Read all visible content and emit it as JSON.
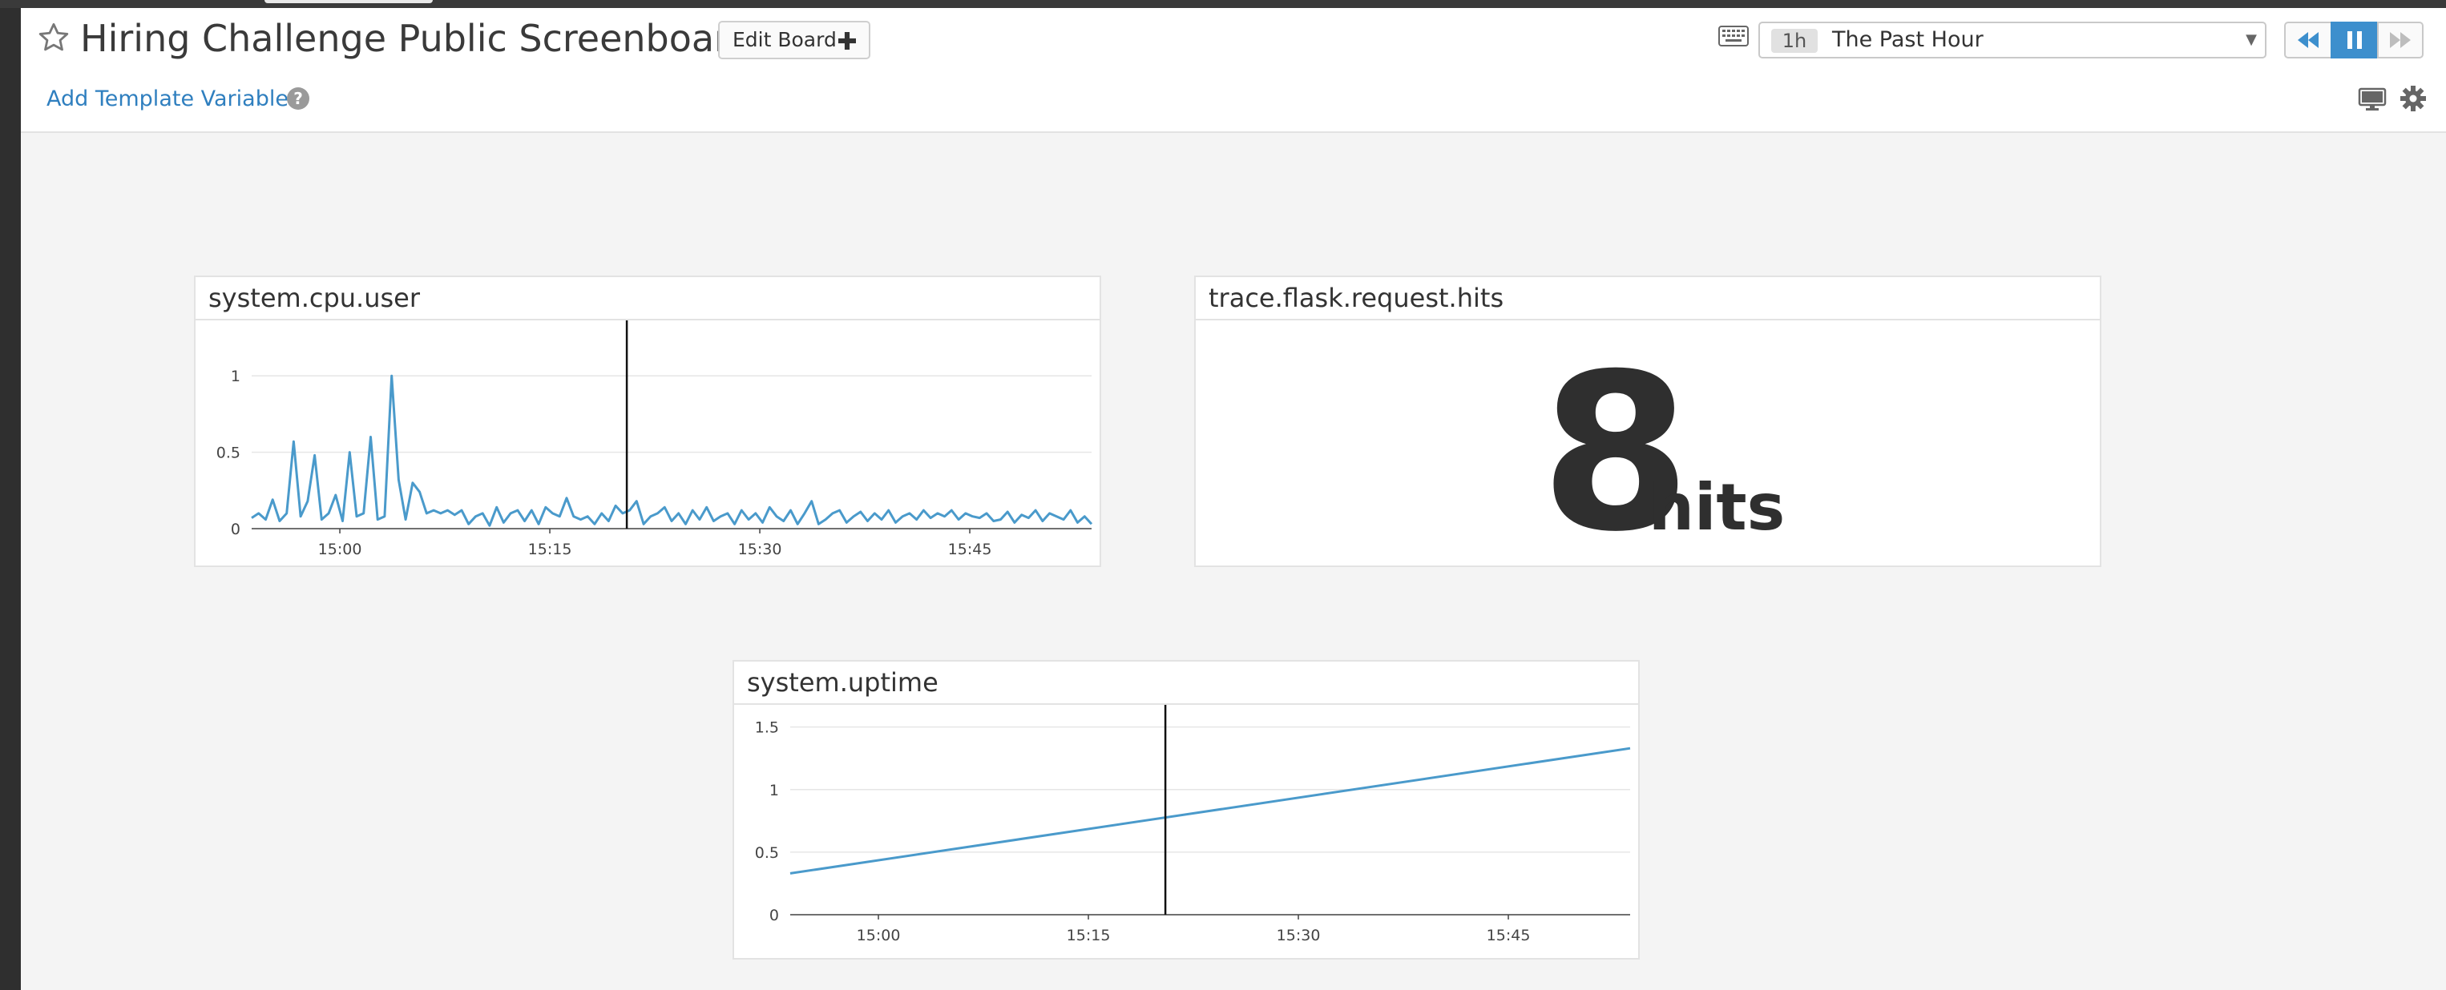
{
  "header": {
    "title": "Hiring Challenge Public Screenboard",
    "edit_label": "Edit Board",
    "add_template_label": "Add Template Variables",
    "timeframe": {
      "chip": "1h",
      "label": "The Past Hour"
    }
  },
  "colors": {
    "accent": "#3d8fcd",
    "series": "#4a9acb",
    "link": "#2f7fbf"
  },
  "widgets": {
    "cpu": {
      "title": "system.cpu.user"
    },
    "hits": {
      "title": "trace.flask.request.hits",
      "value": "8",
      "unit": "hits"
    },
    "uptime": {
      "title": "system.uptime"
    }
  },
  "chart_data": [
    {
      "type": "line",
      "title": "system.cpu.user",
      "x_tick_labels": [
        "15:00",
        "15:15",
        "15:30",
        "15:45"
      ],
      "x_tick_minutes": [
        0,
        15,
        30,
        45
      ],
      "xlim_minutes": [
        -6.3,
        53.7
      ],
      "ylim": [
        0,
        1.3
      ],
      "y_ticks": [
        0,
        0.5,
        1
      ],
      "marker_minutes": 20.5,
      "series": [
        {
          "x_minutes": [
            -6.3,
            -5.8,
            -5.3,
            -4.8,
            -4.3,
            -3.8,
            -3.3,
            -2.8,
            -2.3,
            -1.8,
            -1.3,
            -0.8,
            -0.3,
            0.2,
            0.7,
            1.2,
            1.7,
            2.2,
            2.7,
            3.2,
            3.7,
            4.2,
            4.7,
            5.2,
            5.7,
            6.2,
            6.7,
            7.2,
            7.7,
            8.2,
            8.7,
            9.2,
            9.7,
            10.2,
            10.7,
            11.2,
            11.7,
            12.2,
            12.7,
            13.2,
            13.7,
            14.2,
            14.7,
            15.2,
            15.7,
            16.2,
            16.7,
            17.2,
            17.7,
            18.2,
            18.7,
            19.2,
            19.7,
            20.2,
            20.7,
            21.2,
            21.7,
            22.2,
            22.7,
            23.2,
            23.7,
            24.2,
            24.7,
            25.2,
            25.7,
            26.2,
            26.7,
            27.2,
            27.7,
            28.2,
            28.7,
            29.2,
            29.7,
            30.2,
            30.7,
            31.2,
            31.7,
            32.2,
            32.7,
            33.2,
            33.7,
            34.2,
            34.7,
            35.2,
            35.7,
            36.2,
            36.7,
            37.2,
            37.7,
            38.2,
            38.7,
            39.2,
            39.7,
            40.2,
            40.7,
            41.2,
            41.7,
            42.2,
            42.7,
            43.2,
            43.7,
            44.2,
            44.7,
            45.2,
            45.7,
            46.2,
            46.7,
            47.2,
            47.7,
            48.2,
            48.7,
            49.2,
            49.7,
            50.2,
            50.7,
            51.2,
            51.7,
            52.2,
            52.7,
            53.2,
            53.7
          ],
          "values": [
            0.07,
            0.1,
            0.06,
            0.19,
            0.05,
            0.1,
            0.57,
            0.08,
            0.18,
            0.48,
            0.06,
            0.1,
            0.22,
            0.05,
            0.5,
            0.08,
            0.1,
            0.6,
            0.06,
            0.08,
            1.0,
            0.32,
            0.06,
            0.3,
            0.24,
            0.1,
            0.12,
            0.1,
            0.12,
            0.09,
            0.12,
            0.03,
            0.08,
            0.1,
            0.02,
            0.14,
            0.04,
            0.1,
            0.12,
            0.05,
            0.12,
            0.03,
            0.14,
            0.1,
            0.08,
            0.2,
            0.08,
            0.06,
            0.08,
            0.03,
            0.1,
            0.05,
            0.15,
            0.1,
            0.12,
            0.18,
            0.03,
            0.08,
            0.1,
            0.14,
            0.05,
            0.1,
            0.03,
            0.12,
            0.06,
            0.14,
            0.05,
            0.08,
            0.1,
            0.03,
            0.12,
            0.06,
            0.1,
            0.04,
            0.14,
            0.08,
            0.05,
            0.12,
            0.03,
            0.1,
            0.18,
            0.03,
            0.06,
            0.1,
            0.12,
            0.04,
            0.08,
            0.11,
            0.05,
            0.1,
            0.06,
            0.12,
            0.04,
            0.08,
            0.1,
            0.06,
            0.12,
            0.07,
            0.1,
            0.08,
            0.12,
            0.06,
            0.1,
            0.08,
            0.07,
            0.1,
            0.05,
            0.06,
            0.11,
            0.04,
            0.09,
            0.07,
            0.12,
            0.05,
            0.1,
            0.08,
            0.06,
            0.12,
            0.04,
            0.08,
            0.03
          ]
        }
      ]
    },
    {
      "type": "line",
      "title": "system.uptime",
      "x_tick_labels": [
        "15:00",
        "15:15",
        "15:30",
        "15:45"
      ],
      "x_tick_minutes": [
        0,
        15,
        30,
        45
      ],
      "xlim_minutes": [
        -6.3,
        53.7
      ],
      "ylim": [
        0,
        1.6
      ],
      "y_ticks": [
        0,
        0.5,
        1,
        1.5
      ],
      "marker_minutes": 20.5,
      "series": [
        {
          "x_minutes": [
            -6.3,
            53.7
          ],
          "values": [
            0.33,
            1.33
          ]
        }
      ]
    }
  ]
}
